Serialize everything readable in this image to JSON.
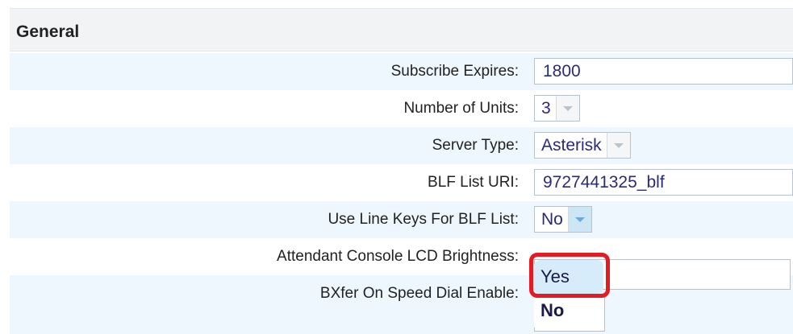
{
  "section": {
    "title": "General"
  },
  "rows": {
    "subscribe_expires": {
      "label": "Subscribe Expires:",
      "value": "1800"
    },
    "number_of_units": {
      "label": "Number of Units:",
      "value": "3"
    },
    "server_type": {
      "label": "Server Type:",
      "value": "Asterisk"
    },
    "blf_list_uri": {
      "label": "BLF List URI:",
      "value": "9727441325_blf"
    },
    "use_line_keys": {
      "label": "Use Line Keys For BLF List:",
      "value": "No"
    },
    "attendant_brightness": {
      "label": "Attendant Console LCD Brightness:"
    },
    "bxfer_speed_dial": {
      "label": "BXfer On Speed Dial Enable:"
    }
  },
  "dropdown": {
    "options": [
      "Yes",
      "No"
    ],
    "hovered": "Yes"
  },
  "colors": {
    "highlight": "#e51b24",
    "row_alt": "#eef7fd",
    "value_text": "#2a2a7a"
  }
}
